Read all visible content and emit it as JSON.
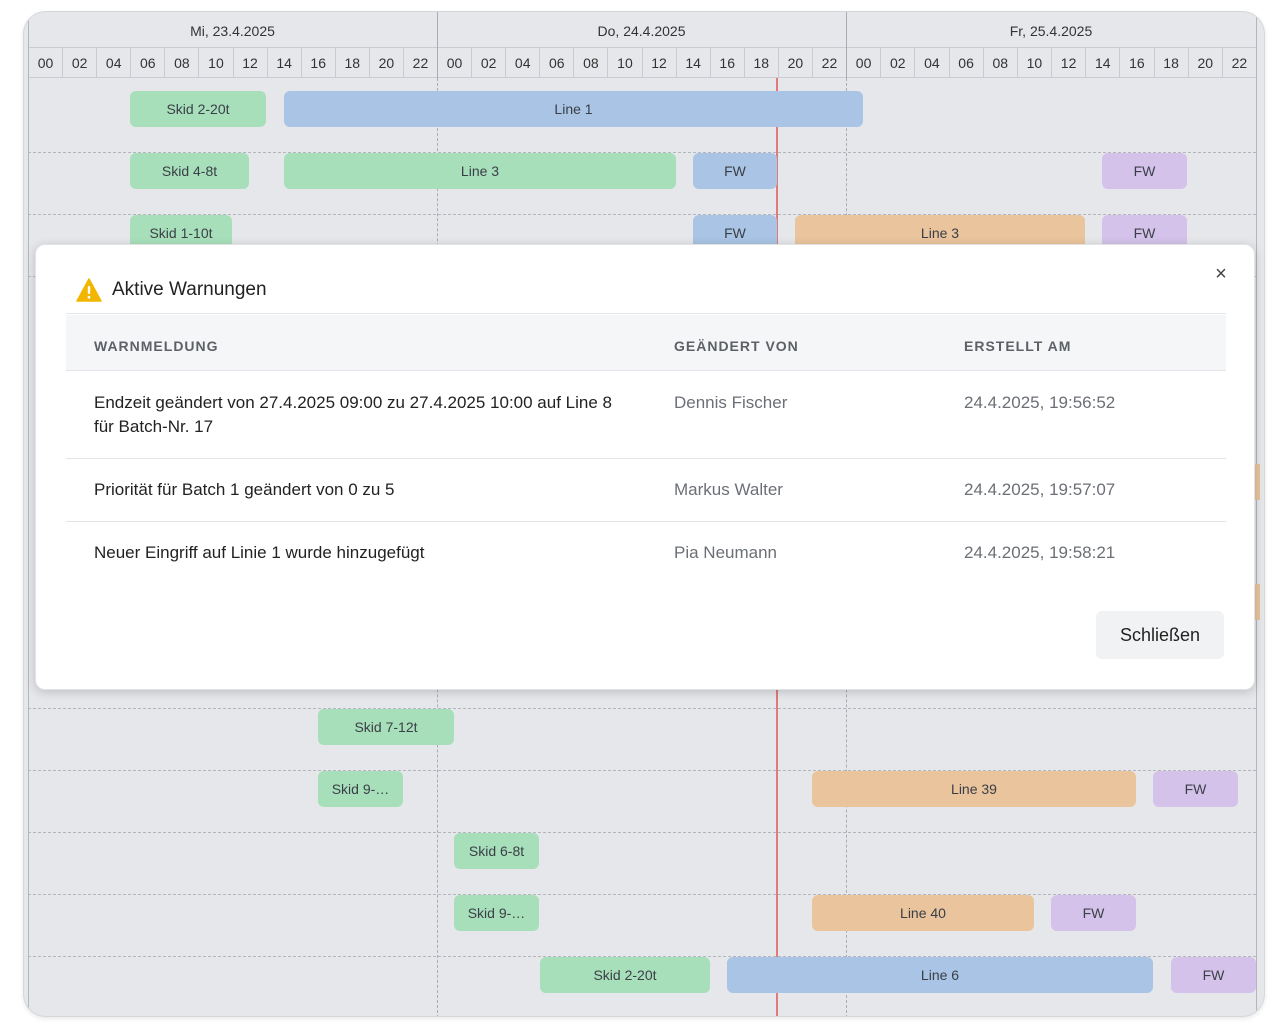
{
  "timeline": {
    "days": [
      "Mi, 23.4.2025",
      "Do, 24.4.2025",
      "Fr, 25.4.2025"
    ],
    "hours": [
      "00",
      "02",
      "04",
      "06",
      "08",
      "10",
      "12",
      "14",
      "16",
      "18",
      "20",
      "22"
    ]
  },
  "bars": [
    {
      "label": "Skid 2-20t",
      "color": "green"
    },
    {
      "label": "Line 1",
      "color": "blue"
    },
    {
      "label": "Skid 4-8t",
      "color": "green"
    },
    {
      "label": "Line 3",
      "color": "green"
    },
    {
      "label": "FW",
      "color": "blue"
    },
    {
      "label": "FW",
      "color": "purple"
    },
    {
      "label": "Skid 1-10t",
      "color": "green"
    },
    {
      "label": "FW",
      "color": "blue"
    },
    {
      "label": "Line 3",
      "color": "orange"
    },
    {
      "label": "FW",
      "color": "purple"
    },
    {
      "label": "Skid 7-12t",
      "color": "green"
    },
    {
      "label": "Skid 9-…",
      "color": "green"
    },
    {
      "label": "Line 39",
      "color": "orange"
    },
    {
      "label": "FW",
      "color": "purple"
    },
    {
      "label": "Skid 6-8t",
      "color": "green"
    },
    {
      "label": "Skid 9-…",
      "color": "green"
    },
    {
      "label": "Line 40",
      "color": "orange"
    },
    {
      "label": "FW",
      "color": "purple"
    },
    {
      "label": "Skid 2-20t",
      "color": "green"
    },
    {
      "label": "Line 6",
      "color": "blue"
    },
    {
      "label": "FW",
      "color": "purple"
    }
  ],
  "colors": {
    "green": "#a8dfbb",
    "blue": "#a9c4e4",
    "orange": "#eac49c",
    "purple": "#d4c2ea",
    "now_line": "#e07b7b",
    "warning": "#f2b600"
  },
  "modal": {
    "title": "Aktive Warnungen",
    "icon": "warning-triangle-icon",
    "columns": [
      "WARNMELDUNG",
      "GEÄNDERT VON",
      "ERSTELLT AM"
    ],
    "rows": [
      {
        "message": "Endzeit geändert von 27.4.2025 09:00 zu 27.4.2025 10:00 auf Line 8 für Batch-Nr. 17",
        "changed_by": "Dennis Fischer",
        "created": "24.4.2025, 19:56:52"
      },
      {
        "message": "Priorität für Batch 1 geändert von 0 zu 5",
        "changed_by": "Markus Walter",
        "created": "24.4.2025, 19:57:07"
      },
      {
        "message": "Neuer Eingriff auf Linie 1 wurde hinzugefügt",
        "changed_by": "Pia Neumann",
        "created": "24.4.2025, 19:58:21"
      }
    ],
    "close_label": "Schließen",
    "close_icon": "×"
  }
}
